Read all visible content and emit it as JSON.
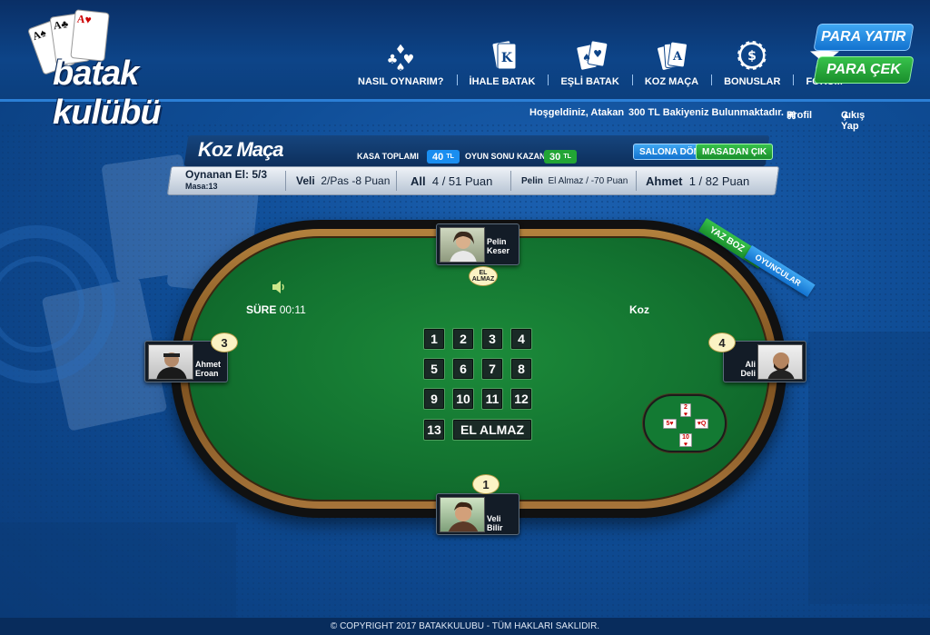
{
  "brand": {
    "name": "batak kulübü"
  },
  "nav": [
    {
      "label": "NASIL OYNARIM?",
      "icon": "card-suits-icon"
    },
    {
      "label": "İHALE BATAK",
      "icon": "king-card-icon"
    },
    {
      "label": "EŞLİ BATAK",
      "icon": "two-cards-icon"
    },
    {
      "label": "KOZ MAÇA",
      "icon": "ace-cards-icon"
    },
    {
      "label": "BONUSLAR",
      "icon": "chip-dollar-icon"
    },
    {
      "label": "FORUM",
      "icon": "star-icon"
    }
  ],
  "actions": {
    "deposit": "PARA YATIR",
    "withdraw": "PARA ÇEK"
  },
  "userbar": {
    "welcome": "Hoşgeldiniz, Atakan",
    "balance": "300 TL Bakiyeniz Bulunmaktadır.",
    "profile": "Profil",
    "logout": "Çıkış Yap"
  },
  "game": {
    "title": "Koz Maça",
    "kasa_label": "KASA TOPLAMI",
    "kasa_value": "40",
    "kasa_unit": "TL",
    "kazanc_label": "OYUN SONU KAZANÇ",
    "kazanc_value": "30",
    "kazanc_unit": "TL",
    "back_button": "SALONA DÖN",
    "leave_button": "MASADAN ÇIK",
    "played_label": "Oynanan El: 5/3",
    "table_label": "Masa:13",
    "score1_name": "Veli",
    "score1_detail": "2/Pas  -8 Puan",
    "score2_name": "All",
    "score2_detail": "4  /  51 Puan",
    "score3_name": "Pelin",
    "score3_detail": "El Almaz / -70 Puan",
    "score4_name": "Ahmet",
    "score4_detail": "1  /  82 Puan"
  },
  "table": {
    "ribbon1": "YAZ BOZ",
    "ribbon2": "OYUNCULAR",
    "timer_label": "SÜRE",
    "timer_value": "00:11",
    "trump_label": "Koz",
    "bids": [
      "1",
      "2",
      "3",
      "4",
      "5",
      "6",
      "7",
      "8",
      "9",
      "10",
      "11",
      "12",
      "13"
    ],
    "pass_bid": "EL ALMAZ"
  },
  "players": {
    "top": {
      "first": "Pelin",
      "last": "Keser",
      "tag_line1": "EL",
      "tag_line2": "ALMAZ"
    },
    "left": {
      "first": "Ahmet",
      "last": "Eroan",
      "bid": "3"
    },
    "right": {
      "first": "Ali",
      "last": "Deli",
      "bid": "4"
    },
    "bottom": {
      "first": "Veli",
      "last": "Bilir",
      "bid": "1"
    }
  },
  "trick_cards": [
    {
      "rank": "2",
      "suit": "♥"
    },
    {
      "rank": "5",
      "suit": "♥"
    },
    {
      "rank": "Q",
      "suit": "♥"
    },
    {
      "rank": "10",
      "suit": "♥"
    }
  ],
  "footer": "© COPYRIGHT 2017 BATAKKULUBU - TÜM HAKLARI SAKLIDIR.",
  "colors": {
    "accent_blue": "#1a8ef0",
    "accent_green": "#22a535",
    "felt": "#137330",
    "header": "#0d4488"
  }
}
